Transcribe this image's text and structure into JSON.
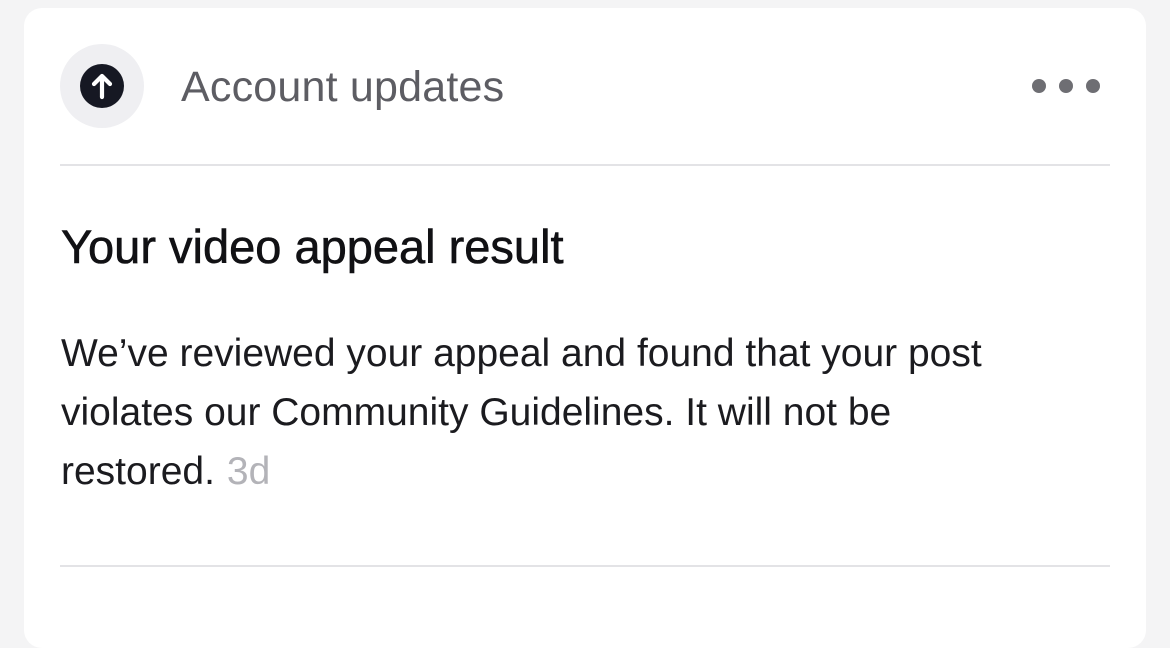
{
  "header": {
    "icon": "arrow-up-circle-icon",
    "title": "Account updates",
    "more_icon": "more-horizontal-icon"
  },
  "notification": {
    "title": "Your video appeal result",
    "body": "We’ve reviewed your appeal and found that your post violates our Community Guidelines. It will not be restored.",
    "timestamp": "3d"
  },
  "colors": {
    "background": "#f4f4f5",
    "card": "#ffffff",
    "icon_bubble": "#efeff2",
    "icon_fill": "#161823",
    "header_text": "#5d5d63",
    "title_text": "#111114",
    "timestamp_text": "#b3b3b8",
    "divider": "#e3e3e6"
  }
}
